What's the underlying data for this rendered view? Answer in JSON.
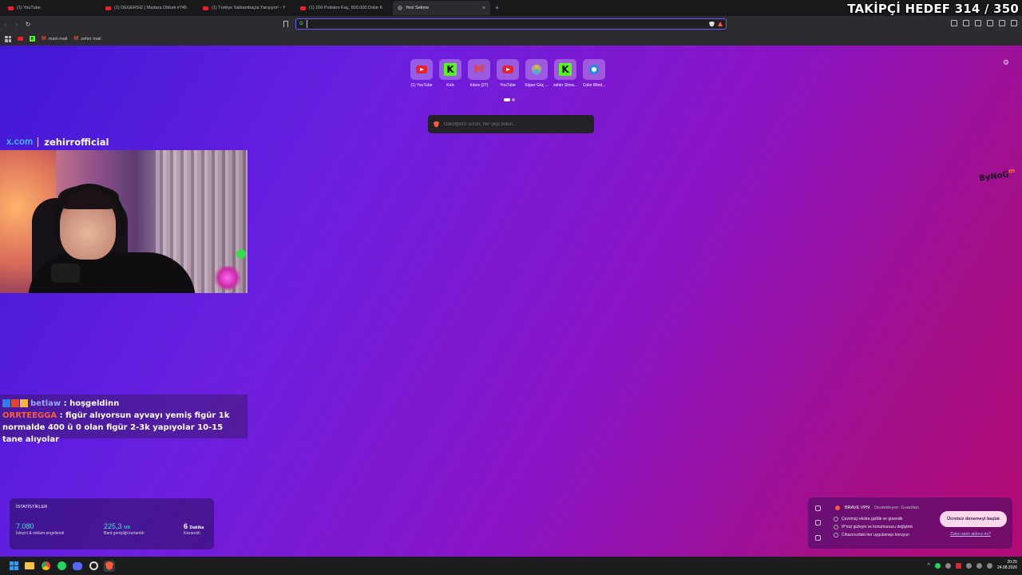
{
  "tabs": [
    {
      "label": "(1) YouTube",
      "icon": "youtube-icon",
      "active": false
    },
    {
      "label": "(1) DEĞERSİZ | Madara Oldurk #745",
      "icon": "youtube-icon",
      "active": false
    },
    {
      "label": "(1) Türkiye Saklambaçta Yarışıyor! - Y",
      "icon": "youtube-icon",
      "active": false
    },
    {
      "label": "(1) 100 Polisten Kaç, 500.000 Dolar K",
      "icon": "youtube-icon",
      "active": false
    },
    {
      "label": "Yeni Sekme",
      "icon": "brave-icon",
      "active": true
    }
  ],
  "overlay": {
    "follower_goal": "TAKİPÇİ HEDEF 314 / 350"
  },
  "toolbar": {
    "url_value": "",
    "search_engine_icon": "google-icon"
  },
  "bookmarks": [
    {
      "label": "",
      "icon": "youtube-icon"
    },
    {
      "label": "",
      "icon": "kick-icon"
    },
    {
      "label": "main mail",
      "icon": "gmail-icon"
    },
    {
      "label": "zehirr mail",
      "icon": "gmail-icon"
    }
  ],
  "top_sites": [
    {
      "label": "(1) YouTube",
      "icon": "youtube-icon"
    },
    {
      "label": "Kick",
      "icon": "kick-icon"
    },
    {
      "label": "Inbox (27)",
      "icon": "gmail-icon"
    },
    {
      "label": "YouTube",
      "icon": "youtube-icon"
    },
    {
      "label": "Süper Güç ...",
      "icon": "globe-icon"
    },
    {
      "label": "zehirr Strea...",
      "icon": "kick-icon"
    },
    {
      "label": "Color Blind...",
      "icon": "colorblind-icon"
    }
  ],
  "search": {
    "placeholder": "Dilediğinizi sorun, her şeyi bulun..."
  },
  "stream": {
    "x_site": "x.com",
    "x_user": "zehirrofficial",
    "watermark": "ByNoG",
    "watermark_mark": "m"
  },
  "chat": [
    {
      "user": "betlaw",
      "message": " : hoşgeldinn"
    },
    {
      "user": "ORRTEEGGA",
      "message": " : figür alıyorsun ayvayı yemiş figür 1k normalde 400 ü 0 olan figür 2-3k yapıyolar 10-15 tane alıyolar"
    }
  ],
  "stats": {
    "title": "İSTATİSTİKLER",
    "items": [
      {
        "value": "7.080",
        "unit": "",
        "label": "İzleyici & reklam engellendi"
      },
      {
        "value": "225,3",
        "unit": "MB",
        "label": "Bant genişliği kurtarıldı"
      },
      {
        "value": "6",
        "unit": "Dakika",
        "label": "Kazanıldı"
      }
    ]
  },
  "vpn": {
    "title": "BRAVE VPN",
    "subtitle": "Destekleyen: Guardian",
    "features": [
      "Çevrimiçi ekstra gizlilik ve güvenlik",
      "IP'nizi gizleyin ve konumunuzu değiştirin",
      "Cihazınızdaki her uygulamayı koruyun"
    ],
    "cta": "Ücretsiz denemeyi başlat",
    "link": "Zaten satın aldınız mı?"
  },
  "taskbar": {
    "time": "20:25",
    "date": "24.08.2026"
  },
  "colors": {
    "accent": "#6b5cff",
    "background_start": "#4019d6",
    "background_end": "#b30a74"
  }
}
